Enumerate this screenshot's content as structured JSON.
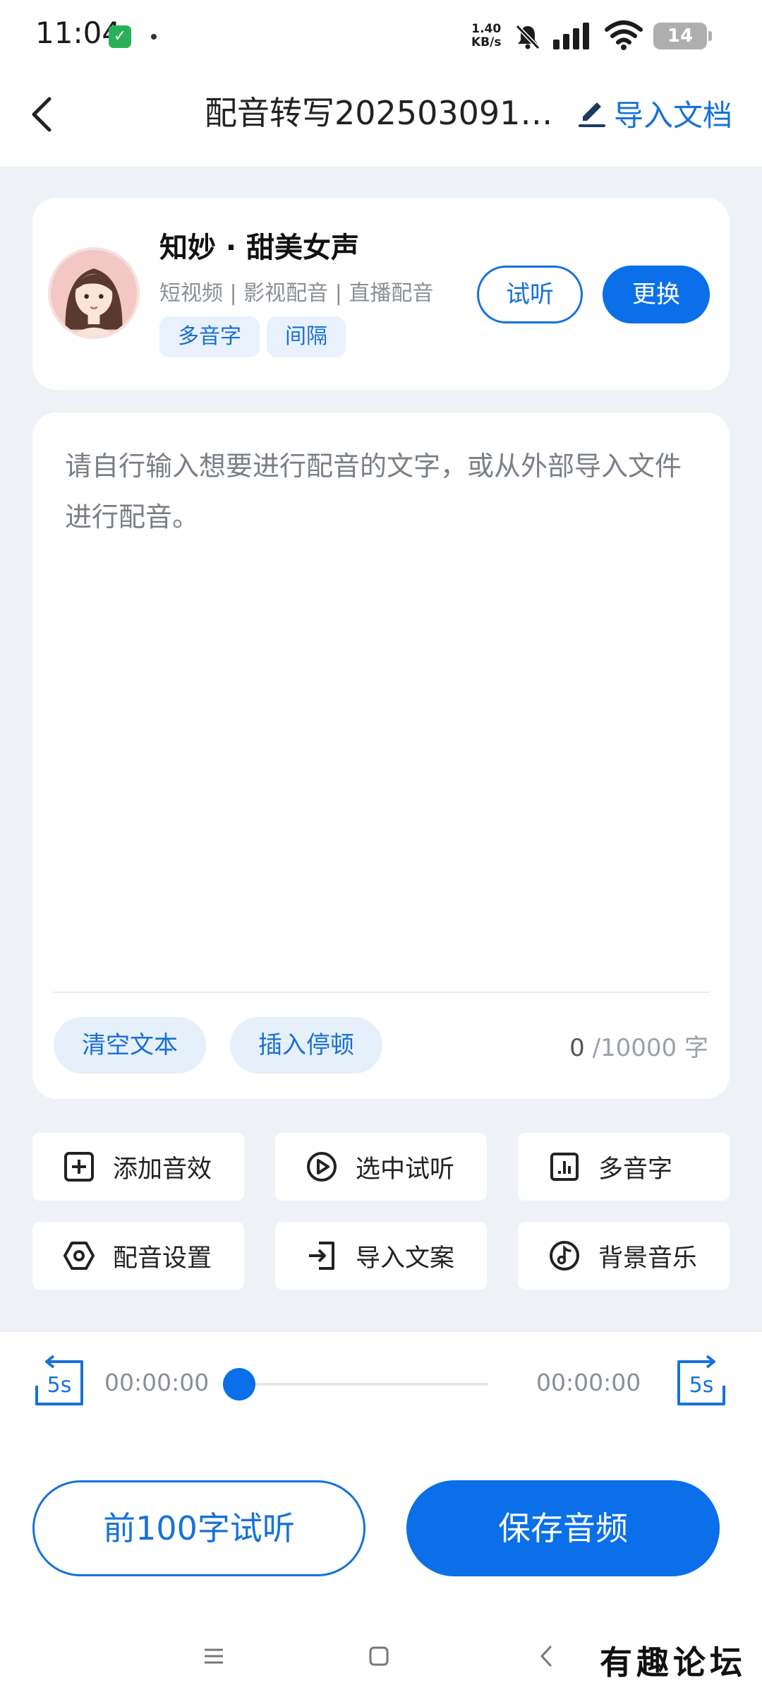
{
  "status_bar": {
    "time": "11:04",
    "net_speed_value": "1.40",
    "net_speed_unit": "KB/s",
    "battery": "14"
  },
  "header": {
    "title": "配音转写2025030911...",
    "import_doc_label": "导入文档"
  },
  "voice": {
    "name": "知妙 · 甜美女声",
    "tags": "短视频 | 影视配音 | 直播配音",
    "chips": [
      "多音字",
      "间隔"
    ],
    "try_label": "试听",
    "change_label": "更换"
  },
  "editor": {
    "placeholder": "请自行输入想要进行配音的文字，或从外部导入文件进行配音。",
    "clear_label": "清空文本",
    "insert_pause_label": "插入停顿",
    "count": "0",
    "limit": " /10000 字"
  },
  "tools": [
    {
      "label": "添加音效",
      "icon": "plus-square-icon"
    },
    {
      "label": "选中试听",
      "icon": "play-circle-icon"
    },
    {
      "label": "多音字",
      "icon": "bar-chart-icon"
    },
    {
      "label": "配音设置",
      "icon": "hexagon-settings-icon"
    },
    {
      "label": "导入文案",
      "icon": "import-icon"
    },
    {
      "label": "背景音乐",
      "icon": "music-note-icon"
    }
  ],
  "player": {
    "skip_back": "5s",
    "skip_forward": "5s",
    "current_time": "00:00:00",
    "total_time": "00:00:00",
    "progress": 0
  },
  "actions": {
    "preview_label": "前100字试听",
    "save_label": "保存音频"
  },
  "watermark": "有趣论坛",
  "colors": {
    "accent": "#0a6fe8",
    "accent_text": "#1672d9",
    "chip_bg": "#e8f1fc",
    "page_bg": "#eef2f6"
  }
}
